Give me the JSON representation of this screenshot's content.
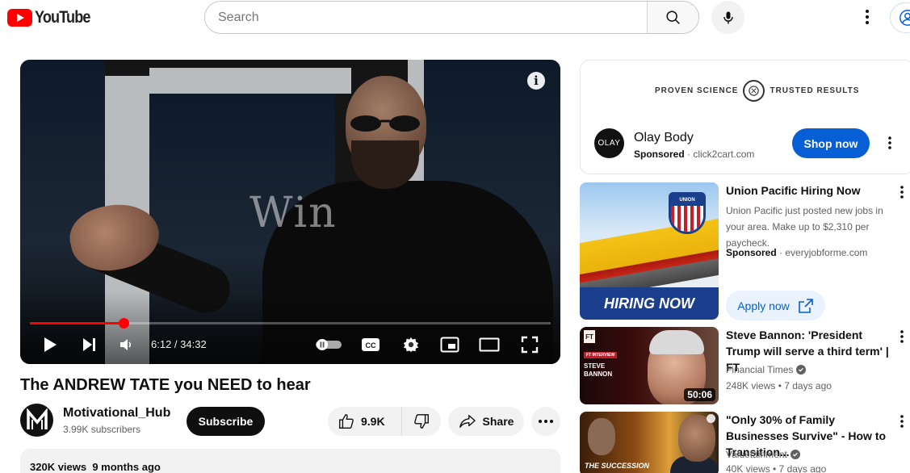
{
  "app": {
    "logo_text": "YouTube"
  },
  "search": {
    "placeholder": "Search"
  },
  "player": {
    "caption_text": "Win",
    "time_display": "6:12 / 34:32",
    "progress_fraction": 0.1797
  },
  "video": {
    "title": "The ANDREW TATE you NEED to hear",
    "channel_name": "Motivational_Hub",
    "channel_subs": "3.99K subscribers",
    "subscribe_label": "Subscribe",
    "like_count": "9.9K",
    "share_label": "Share",
    "views": "320K views",
    "age": "9 months ago"
  },
  "ad_card": {
    "banner_left": "PROVEN SCIENCE",
    "banner_right": "TRUSTED RESULTS",
    "logo_text": "OLAY",
    "advertiser": "Olay Body",
    "sponsored": "Sponsored",
    "separator": " · ",
    "domain": "click2cart.com",
    "cta": "Shop now"
  },
  "sidebar": {
    "items": [
      {
        "title": "Union Pacific Hiring Now",
        "description": "Union Pacific just posted new jobs in your area. Make up to $2,310 per paycheck.",
        "sponsored": "Sponsored",
        "domain": "everyjobforme.com",
        "cta": "Apply now",
        "thumb_band": "HIRING NOW",
        "thumb_logo": "UNION PACIFIC"
      },
      {
        "title": "Steve Bannon: 'President Trump will serve a third term' | FT",
        "channel": "Financial Times",
        "stats": "248K views • 7 days ago",
        "duration": "50:06",
        "thumb_logo": "FT",
        "thumb_tag": "FT INTERVIEW",
        "thumb_name_1": "STEVE",
        "thumb_name_2": "BANNON"
      },
      {
        "title": "\"Only 30% of Family Businesses Survive\" - How to Transition...",
        "channel": "Valuetainment",
        "stats": "40K views • 7 days ago",
        "thumb_label": "THE SUCCESSION"
      }
    ]
  },
  "colors": {
    "brand_red": "#ff0000",
    "cta_blue": "#065fd4",
    "apply_bg": "#e9f2fd",
    "union_pacific_blue": "#1b3f8c"
  },
  "icons": [
    "youtube-logo-icon",
    "search-icon",
    "mic-icon",
    "more-vert-icon",
    "account-icon",
    "info-icon",
    "play-icon",
    "next-icon",
    "volume-icon",
    "autoplay-toggle-icon",
    "captions-icon",
    "settings-icon",
    "miniplayer-icon",
    "theater-icon",
    "fullscreen-icon",
    "thumbs-up-icon",
    "thumbs-down-icon",
    "share-icon",
    "more-horiz-icon",
    "verified-icon",
    "external-link-icon"
  ]
}
